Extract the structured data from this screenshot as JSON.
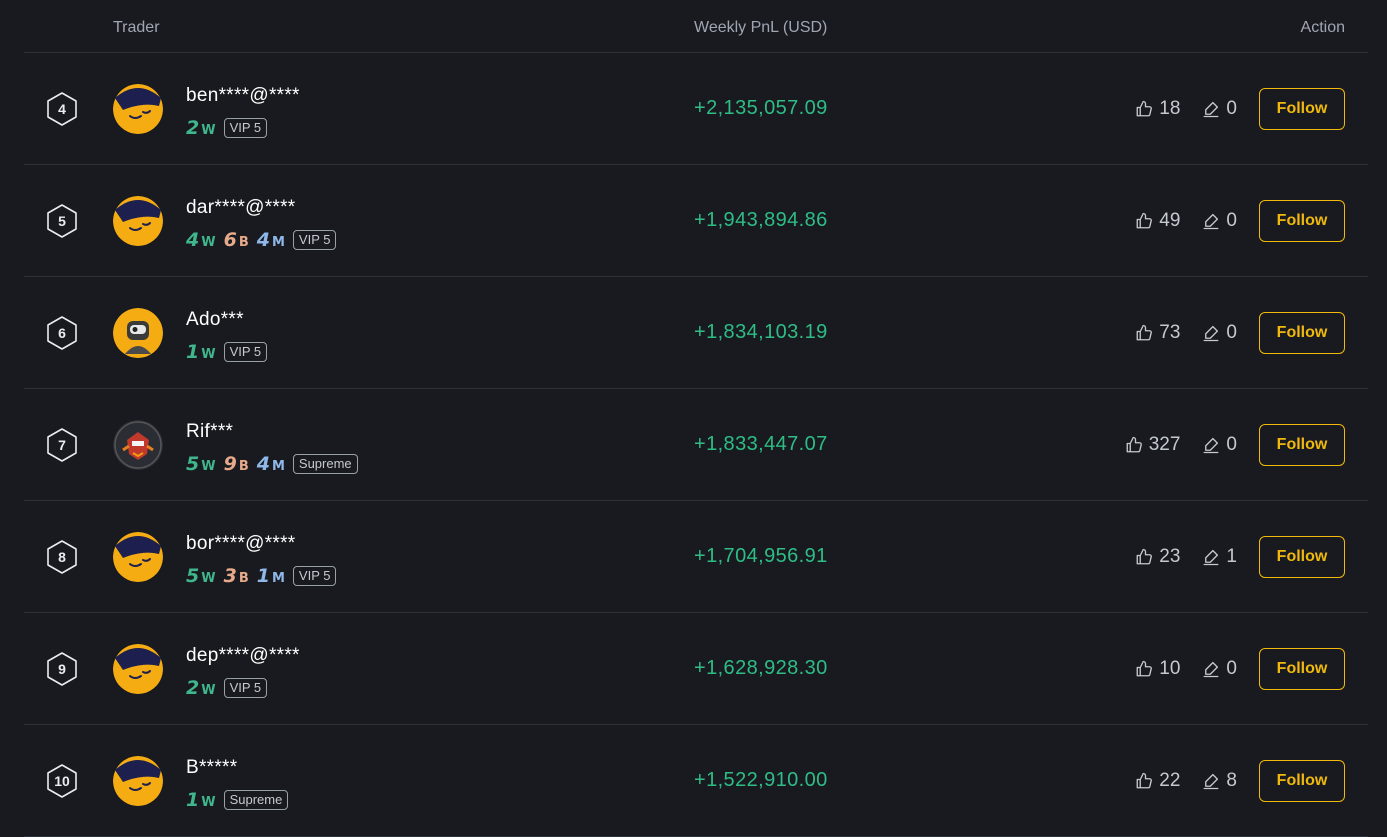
{
  "header": {
    "trader": "Trader",
    "pnl": "Weekly PnL (USD)",
    "action": "Action"
  },
  "follow_label": "Follow",
  "colors": {
    "accent": "#f0b90b",
    "positive": "#2ebd85",
    "background": "#181a20"
  },
  "rows": [
    {
      "rank": "4",
      "name": "ben****@****",
      "avatar": "default-avatar-icon",
      "wins": [
        {
          "n": "2",
          "u": "W"
        }
      ],
      "tier": "VIP 5",
      "pnl": "+2,135,057.09",
      "likes": "18",
      "copies": "0"
    },
    {
      "rank": "5",
      "name": "dar****@****",
      "avatar": "default-avatar-icon",
      "wins": [
        {
          "n": "4",
          "u": "W"
        },
        {
          "n": "6",
          "u": "B"
        },
        {
          "n": "4",
          "u": "M"
        }
      ],
      "tier": "VIP 5",
      "pnl": "+1,943,894.86",
      "likes": "49",
      "copies": "0"
    },
    {
      "rank": "6",
      "name": "Ado***",
      "avatar": "robot-avatar-icon",
      "wins": [
        {
          "n": "1",
          "u": "W"
        }
      ],
      "tier": "VIP 5",
      "pnl": "+1,834,103.19",
      "likes": "73",
      "copies": "0"
    },
    {
      "rank": "7",
      "name": "Rif***",
      "avatar": "mech-avatar-icon",
      "wins": [
        {
          "n": "5",
          "u": "W"
        },
        {
          "n": "9",
          "u": "B"
        },
        {
          "n": "4",
          "u": "M"
        }
      ],
      "tier": "Supreme",
      "pnl": "+1,833,447.07",
      "likes": "327",
      "copies": "0"
    },
    {
      "rank": "8",
      "name": "bor****@****",
      "avatar": "default-avatar-icon",
      "wins": [
        {
          "n": "5",
          "u": "W"
        },
        {
          "n": "3",
          "u": "B"
        },
        {
          "n": "1",
          "u": "M"
        }
      ],
      "tier": "VIP 5",
      "pnl": "+1,704,956.91",
      "likes": "23",
      "copies": "1"
    },
    {
      "rank": "9",
      "name": "dep****@****",
      "avatar": "default-avatar-icon",
      "wins": [
        {
          "n": "2",
          "u": "W"
        }
      ],
      "tier": "VIP 5",
      "pnl": "+1,628,928.30",
      "likes": "10",
      "copies": "0"
    },
    {
      "rank": "10",
      "name": "B*****",
      "avatar": "default-avatar-icon",
      "wins": [
        {
          "n": "1",
          "u": "W"
        }
      ],
      "tier": "Supreme",
      "pnl": "+1,522,910.00",
      "likes": "22",
      "copies": "8"
    }
  ]
}
